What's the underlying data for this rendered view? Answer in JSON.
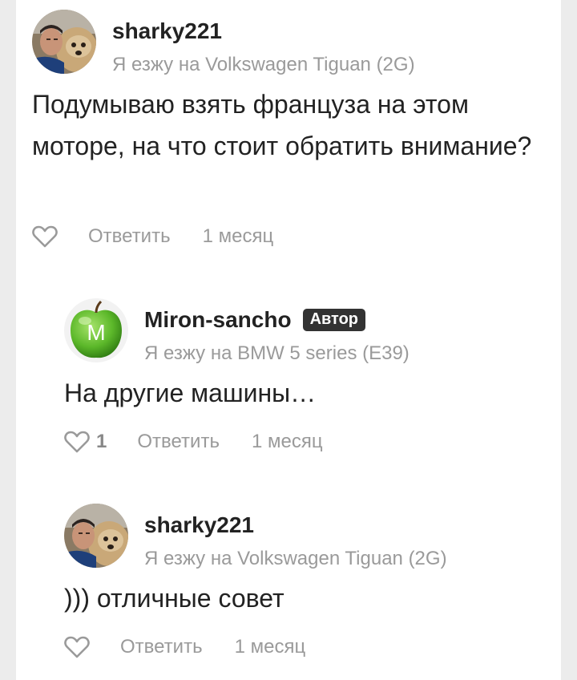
{
  "comments": [
    {
      "author": "sharky221",
      "car": "Я езжу на Volkswagen Tiguan (2G)",
      "text": "Подумываю взять француза на этом моторе, на что стоит обратить внимание?",
      "likes": "",
      "reply_label": "Ответить",
      "time": "1 месяц"
    },
    {
      "author": "Miron-sancho",
      "badge": "Автор",
      "avatar_letter": "M",
      "car": "Я езжу на BMW 5 series (E39)",
      "text": "На другие машины…",
      "likes": "1",
      "reply_label": "Ответить",
      "time": "1 месяц"
    },
    {
      "author": "sharky221",
      "car": "Я езжу на Volkswagen Tiguan (2G)",
      "text": "))) отличные совет",
      "likes": "",
      "reply_label": "Ответить",
      "time": "1 месяц"
    }
  ],
  "colors": {
    "muted": "#9a9a9a",
    "badge_bg": "#333333",
    "apple_green": "#5cb82a"
  }
}
